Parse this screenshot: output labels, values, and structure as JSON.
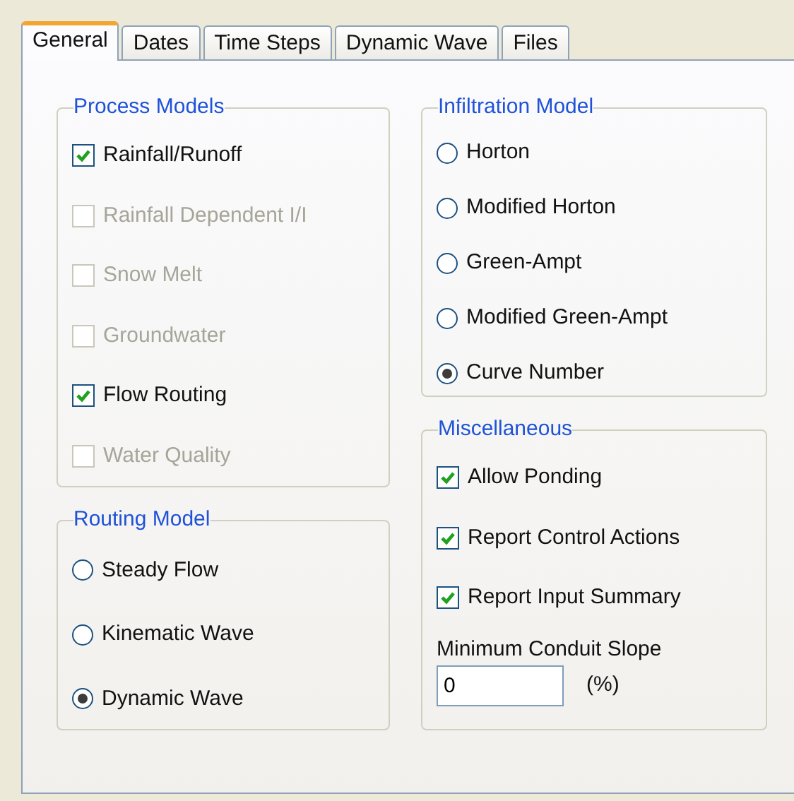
{
  "tabs": [
    {
      "label": "General",
      "selected": true
    },
    {
      "label": "Dates",
      "selected": false
    },
    {
      "label": "Time Steps",
      "selected": false
    },
    {
      "label": "Dynamic Wave",
      "selected": false
    },
    {
      "label": "Files",
      "selected": false
    }
  ],
  "columns": [
    {
      "groups": [
        {
          "title": "Process Models",
          "kind": "checks",
          "items": [
            {
              "label": "Rainfall/Runoff",
              "checked": true,
              "disabled": false
            },
            {
              "label": "Rainfall Dependent I/I",
              "checked": false,
              "disabled": true
            },
            {
              "label": "Snow Melt",
              "checked": false,
              "disabled": true
            },
            {
              "label": "Groundwater",
              "checked": false,
              "disabled": true
            },
            {
              "label": "Flow Routing",
              "checked": true,
              "disabled": false
            },
            {
              "label": "Water Quality",
              "checked": false,
              "disabled": true
            }
          ]
        },
        {
          "title": "Routing Model",
          "kind": "radios",
          "items": [
            {
              "label": "Steady Flow",
              "selected": false
            },
            {
              "label": "Kinematic Wave",
              "selected": false
            },
            {
              "label": "Dynamic Wave",
              "selected": true
            }
          ]
        }
      ]
    },
    {
      "groups": [
        {
          "title": "Infiltration Model",
          "kind": "radios",
          "items": [
            {
              "label": "Horton",
              "selected": false
            },
            {
              "label": "Modified Horton",
              "selected": false
            },
            {
              "label": "Green-Ampt",
              "selected": false
            },
            {
              "label": "Modified Green-Ampt",
              "selected": false
            },
            {
              "label": "Curve Number",
              "selected": true
            }
          ]
        },
        {
          "title": "Miscellaneous",
          "kind": "checks",
          "items": [
            {
              "label": "Allow Ponding",
              "checked": true,
              "disabled": false
            },
            {
              "label": "Report Control Actions",
              "checked": true,
              "disabled": false
            },
            {
              "label": "Report Input Summary",
              "checked": true,
              "disabled": false
            }
          ],
          "field": {
            "label": "Minimum Conduit Slope",
            "value": "0",
            "unit": "(%)"
          }
        }
      ]
    }
  ]
}
